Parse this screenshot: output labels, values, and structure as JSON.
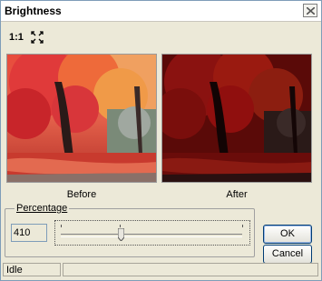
{
  "window": {
    "title": "Brightness",
    "close_icon": "close-icon"
  },
  "toolbar": {
    "actual_size_label": "1:1",
    "fit_icon": "fit-to-window-icon"
  },
  "preview": {
    "before_caption": "Before",
    "after_caption": "After"
  },
  "percentage": {
    "group_label": "Percentage",
    "value": "410",
    "slider_level": 0.33
  },
  "buttons": {
    "ok_label": "OK",
    "cancel_label": "Cancel"
  },
  "status": {
    "text": "Idle"
  },
  "colors": {
    "accent": "#003c74"
  }
}
